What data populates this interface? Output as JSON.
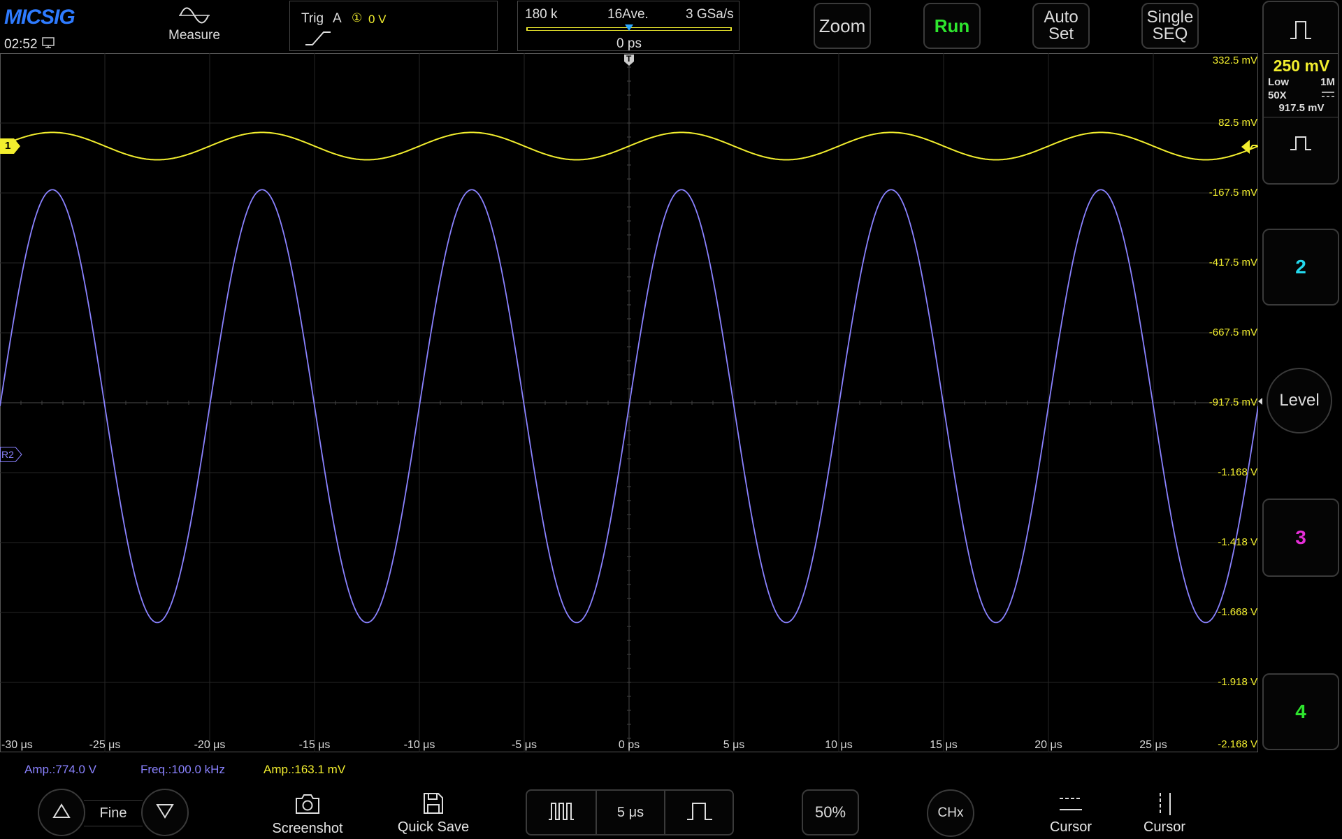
{
  "header": {
    "brand": "MICSIG",
    "time": "02:52",
    "measure_label": "Measure",
    "trigger": {
      "label": "Trig",
      "source": "A",
      "channel_marker": "①",
      "level": "0 V"
    },
    "acquisition": {
      "memory": "180 k",
      "average": "16Ave.",
      "sample_rate": "3 GSa/s",
      "delay": "0 ps"
    },
    "buttons": {
      "zoom": "Zoom",
      "run": "Run",
      "auto_set_1": "Auto",
      "auto_set_2": "Set",
      "single_1": "Single",
      "single_2": "SEQ"
    }
  },
  "channel_panel": {
    "ch1": {
      "scale": "250 mV",
      "bandwidth": "Low",
      "impedance": "1M",
      "probe": "50X",
      "coupling_icon": "dc-coupling-icon",
      "offset": "917.5 mV"
    },
    "ch2_label": "2",
    "ch3_label": "3",
    "ch4_label": "4",
    "level_label": "Level",
    "colors": {
      "ch1": "#f2ee2e",
      "ch2": "#24d9ee",
      "ch3": "#e62ed8",
      "ch4": "#2ee62e"
    }
  },
  "plot": {
    "y_labels": [
      "332.5 mV",
      "82.5 mV",
      "-167.5 mV",
      "-417.5 mV",
      "-667.5 mV",
      "-917.5 mV",
      "-1.168 V",
      "-1.418 V",
      "-1.668 V",
      "-1.918 V",
      "-2.168 V"
    ],
    "x_labels": [
      "-30 μs",
      "-25 μs",
      "-20 μs",
      "-15 μs",
      "-10 μs",
      "-5 μs",
      "0 ps",
      "5 μs",
      "10 μs",
      "15 μs",
      "20 μs",
      "25 μs"
    ],
    "ch1_marker": "1",
    "ref2_marker": "R2",
    "trigger_marker": "T"
  },
  "chart_data": {
    "type": "line",
    "x_unit": "μs",
    "xlim": [
      -30,
      30
    ],
    "ylim": [
      -2.168,
      0.3325
    ],
    "y_unit": "V",
    "series": [
      {
        "name": "1",
        "color": "#f2ee2e",
        "frequency_khz": 100,
        "amplitude_v": 0.1631,
        "center_v": 0.0,
        "phase": "rising-through-0-at-0"
      },
      {
        "name": "R2",
        "color": "#8a82ff",
        "frequency_khz": 100,
        "amplitude_v": 0.774,
        "center_v": -0.93,
        "peak_at_us": 2.5
      }
    ]
  },
  "measurements": {
    "m1": "Amp.:774.0 V",
    "m2": "Freq.:100.0 kHz",
    "m3": "Amp.:163.1 mV"
  },
  "bottom_bar": {
    "fine_label": "Fine",
    "screenshot_label": "Screenshot",
    "quick_save_label": "Quick Save",
    "timebase": "5 μs",
    "fifty_label": "50%",
    "chx_label": "CHx",
    "cursor_h_label": "Cursor",
    "cursor_v_label": "Cursor"
  }
}
